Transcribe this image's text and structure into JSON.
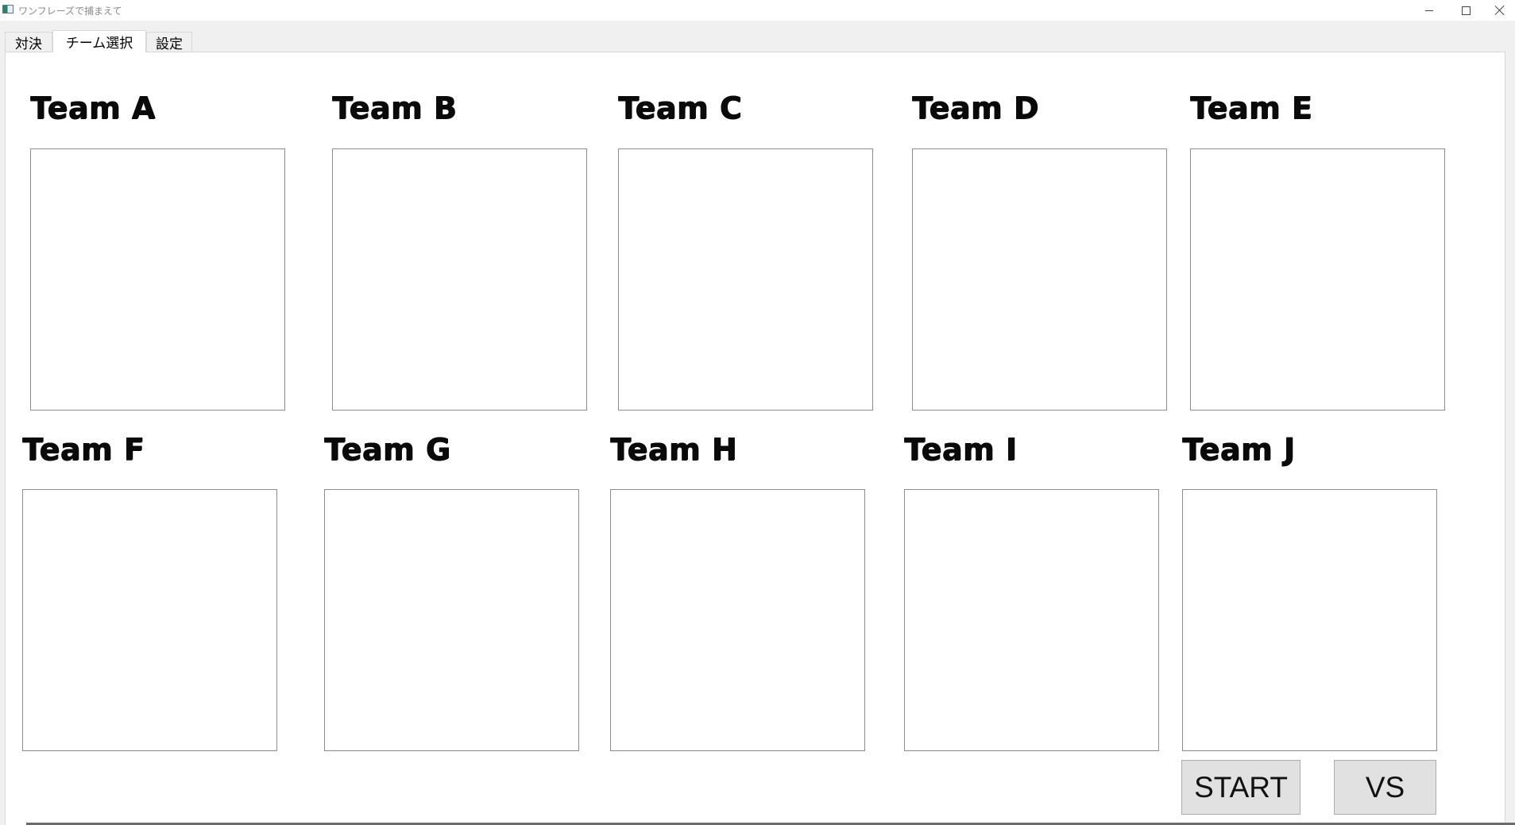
{
  "window": {
    "title": "ワンフレーズで捕まえて",
    "app_icon": "app-window-icon",
    "controls": [
      "minimize-icon",
      "maximize-icon",
      "close-icon"
    ]
  },
  "tabs": [
    {
      "label": "対決",
      "active": false
    },
    {
      "label": "チーム選択",
      "active": true
    },
    {
      "label": "設定",
      "active": false
    }
  ],
  "teams": [
    {
      "label": "Team A"
    },
    {
      "label": "Team B"
    },
    {
      "label": "Team C"
    },
    {
      "label": "Team D"
    },
    {
      "label": "Team E"
    },
    {
      "label": "Team F"
    },
    {
      "label": "Team G"
    },
    {
      "label": "Team H"
    },
    {
      "label": "Team I"
    },
    {
      "label": "Team J"
    }
  ],
  "buttons": {
    "start_label": "START",
    "vs_label": "VS"
  }
}
